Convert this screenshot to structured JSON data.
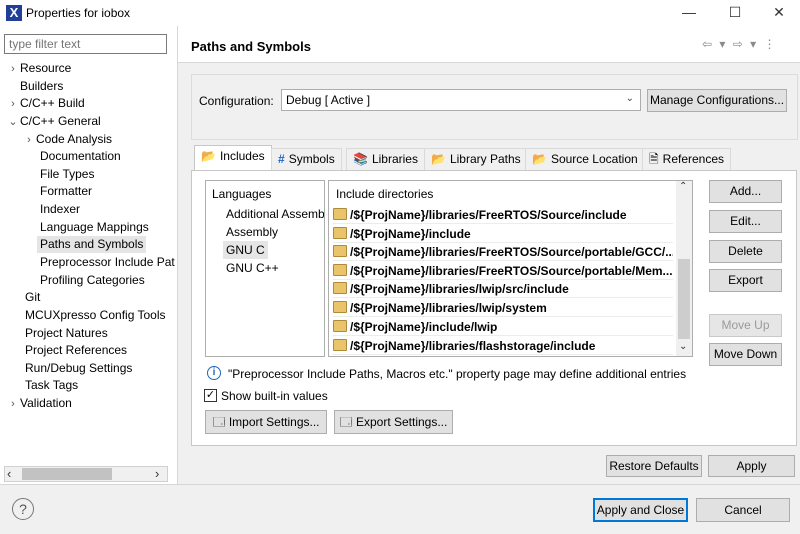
{
  "window": {
    "title": "Properties for iobox",
    "icon_letter": "X",
    "minimize": "—",
    "maximize": "☐",
    "close": "✕"
  },
  "filter": {
    "placeholder": "type filter text"
  },
  "tree": [
    {
      "label": "Resource",
      "twist": "›"
    },
    {
      "label": "Builders",
      "twist": ""
    },
    {
      "label": "C/C++ Build",
      "twist": "›"
    },
    {
      "label": "C/C++ General",
      "twist": "⌄"
    },
    {
      "label": "Code Analysis",
      "twist": "›"
    },
    {
      "label": "Documentation",
      "twist": ""
    },
    {
      "label": "File Types",
      "twist": ""
    },
    {
      "label": "Formatter",
      "twist": ""
    },
    {
      "label": "Indexer",
      "twist": ""
    },
    {
      "label": "Language Mappings",
      "twist": ""
    },
    {
      "label": "Paths and Symbols",
      "twist": ""
    },
    {
      "label": "Preprocessor Include Pat",
      "twist": ""
    },
    {
      "label": "Profiling Categories",
      "twist": ""
    },
    {
      "label": "Git",
      "twist": ""
    },
    {
      "label": "MCUXpresso Config Tools",
      "twist": ""
    },
    {
      "label": "Project Natures",
      "twist": ""
    },
    {
      "label": "Project References",
      "twist": ""
    },
    {
      "label": "Run/Debug Settings",
      "twist": ""
    },
    {
      "label": "Task Tags",
      "twist": ""
    },
    {
      "label": "Validation",
      "twist": "›"
    }
  ],
  "scroll": {
    "left": "‹",
    "right": "›"
  },
  "page": {
    "title": "Paths and Symbols",
    "nav_arrows": "⇦ ▾ ⇨ ▾ ⋮"
  },
  "config": {
    "label": "Configuration:",
    "value": "Debug  [ Active ]",
    "manage_button": "Manage Configurations..."
  },
  "tabs": [
    {
      "label": "Includes",
      "icon": "📂"
    },
    {
      "label": "Symbols",
      "icon": "#"
    },
    {
      "label": "Libraries",
      "icon": "📚"
    },
    {
      "label": "Library Paths",
      "icon": "📂"
    },
    {
      "label": "Source Location",
      "icon": "📂"
    },
    {
      "label": "References",
      "icon": "🗎"
    }
  ],
  "languages": {
    "header": "Languages",
    "items": [
      "Additional Assemb",
      "Assembly",
      "GNU C",
      "GNU C++"
    ]
  },
  "includes": {
    "header": "Include directories",
    "items": [
      "/${ProjName}/libraries/FreeRTOS/Source/include",
      "/${ProjName}/include",
      "/${ProjName}/libraries/FreeRTOS/Source/portable/GCC/...",
      "/${ProjName}/libraries/FreeRTOS/Source/portable/Mem...",
      "/${ProjName}/libraries/lwip/src/include",
      "/${ProjName}/libraries/lwip/system",
      "/${ProjName}/include/lwip",
      "/${ProjName}/libraries/flashstorage/include"
    ]
  },
  "side_buttons": {
    "add": "Add...",
    "edit": "Edit...",
    "delete": "Delete",
    "export": "Export",
    "move_up": "Move Up",
    "move_down": "Move Down"
  },
  "info_text": "\"Preprocessor Include Paths, Macros etc.\" property page may define additional entries",
  "show_builtin": "Show built-in values",
  "import_button": "Import Settings...",
  "export_button": "Export Settings...",
  "restore_button": "Restore Defaults",
  "apply_button": "Apply",
  "apply_close_button": "Apply and Close",
  "cancel_button": "Cancel",
  "help_icon": "?"
}
